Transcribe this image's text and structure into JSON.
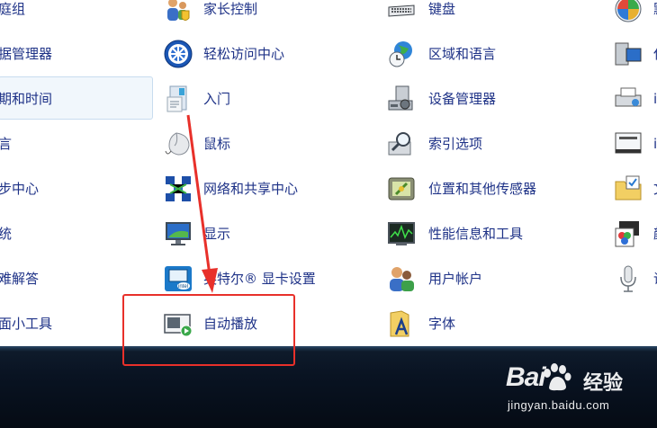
{
  "control_panel": {
    "col1": [
      {
        "label": "庭组"
      },
      {
        "label": "据管理器"
      },
      {
        "label": "期和时间"
      },
      {
        "label": "言"
      },
      {
        "label": "步中心"
      },
      {
        "label": "统"
      },
      {
        "label": "难解答"
      },
      {
        "label": "面小工具"
      }
    ],
    "col2": [
      {
        "label": "家长控制",
        "icon": "parental-control-icon"
      },
      {
        "label": "轻松访问中心",
        "icon": "ease-of-access-icon"
      },
      {
        "label": "入门",
        "icon": "getting-started-icon"
      },
      {
        "label": "鼠标",
        "icon": "mouse-icon"
      },
      {
        "label": "网络和共享中心",
        "icon": "network-sharing-icon"
      },
      {
        "label": "显示",
        "icon": "display-icon"
      },
      {
        "label": "英特尔® 显卡设置",
        "icon": "intel-graphics-icon"
      },
      {
        "label": "自动播放",
        "icon": "autoplay-icon"
      }
    ],
    "col3": [
      {
        "label": "键盘",
        "icon": "keyboard-icon"
      },
      {
        "label": "区域和语言",
        "icon": "region-language-icon"
      },
      {
        "label": "设备管理器",
        "icon": "device-manager-icon"
      },
      {
        "label": "索引选项",
        "icon": "indexing-options-icon"
      },
      {
        "label": "位置和其他传感器",
        "icon": "location-sensors-icon"
      },
      {
        "label": "性能信息和工具",
        "icon": "performance-icon"
      },
      {
        "label": "用户帐户",
        "icon": "user-accounts-icon"
      },
      {
        "label": "字体",
        "icon": "fonts-icon"
      }
    ],
    "col4_partial": [
      "默",
      "任",
      "i",
      "i",
      "文",
      "颜",
      "语"
    ]
  },
  "watermark": {
    "brand": "Bai",
    "brand_cn": "经验",
    "site": "jingyan.baidu.com"
  },
  "colors": {
    "link": "#1e3287",
    "highlight_bg": "#f1f7fc",
    "annotation_red": "#e8302a",
    "taskbar": "#091322"
  }
}
